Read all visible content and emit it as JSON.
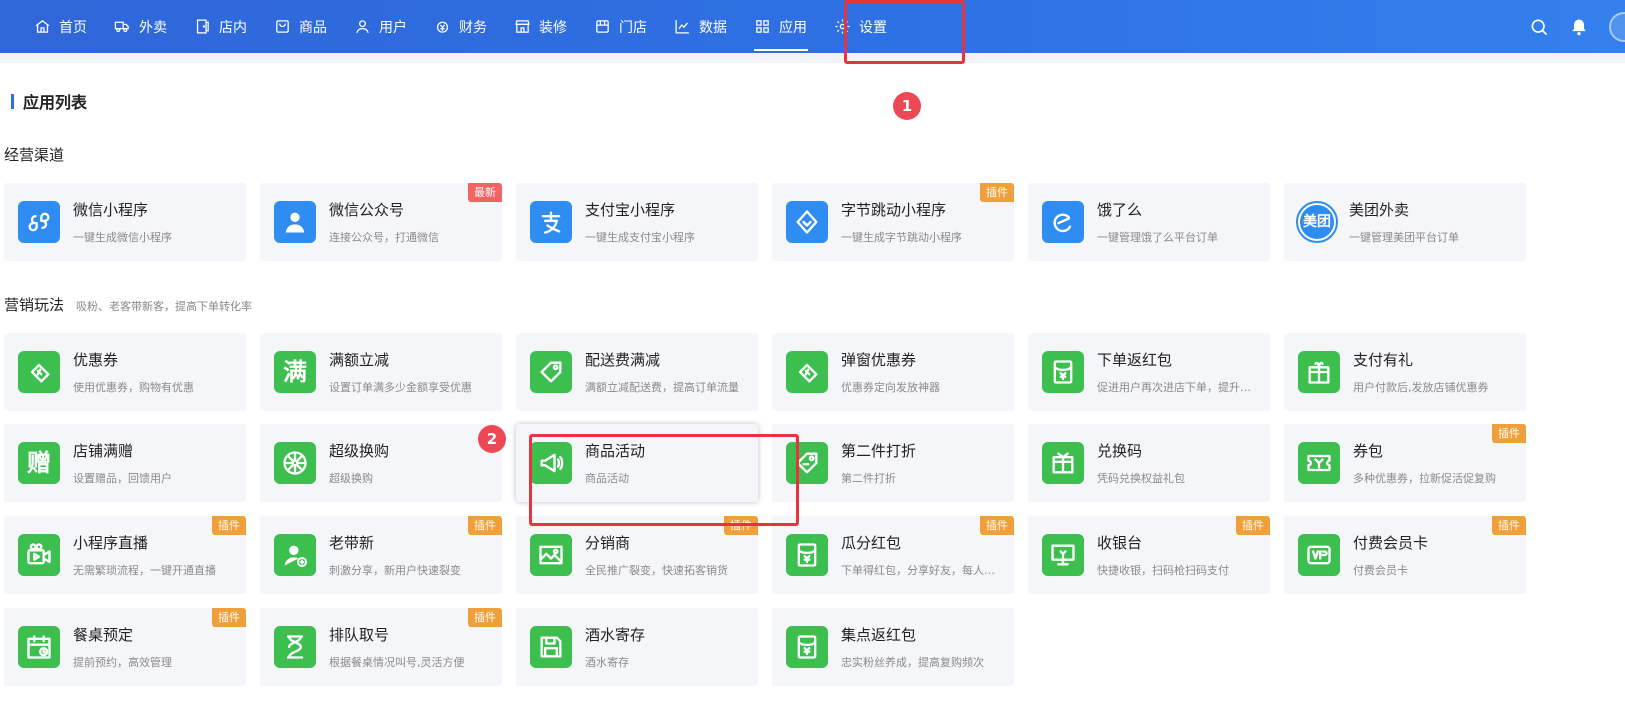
{
  "nav": {
    "items": [
      {
        "label": "首页",
        "icon": "home-icon"
      },
      {
        "label": "外卖",
        "icon": "delivery-icon"
      },
      {
        "label": "店内",
        "icon": "store-door-icon"
      },
      {
        "label": "商品",
        "icon": "product-icon"
      },
      {
        "label": "用户",
        "icon": "user-icon"
      },
      {
        "label": "财务",
        "icon": "finance-icon"
      },
      {
        "label": "装修",
        "icon": "decoration-icon"
      },
      {
        "label": "门店",
        "icon": "shop-icon"
      },
      {
        "label": "数据",
        "icon": "chart-icon"
      },
      {
        "label": "应用",
        "icon": "apps-icon",
        "active": true
      },
      {
        "label": "设置",
        "icon": "gear-icon"
      }
    ]
  },
  "markers": {
    "one": "1",
    "two": "2"
  },
  "page_title": "应用列表",
  "sections": {
    "channels": {
      "title": "经营渠道",
      "subtitle": ""
    },
    "marketing": {
      "title": "营销玩法",
      "subtitle": "吸粉、老客带新客，提高下单转化率"
    }
  },
  "colors": {
    "nav": "#2e6ee6",
    "blue_icon": "#2f8cf0",
    "green_icon": "#3cbf4f",
    "tag_orange": "#f0a03a",
    "tag_red": "#f26363",
    "highlight": "#e8323c"
  },
  "channels": [
    {
      "name": "微信小程序",
      "desc": "一键生成微信小程序",
      "icon": "mini-program-icon",
      "tag": ""
    },
    {
      "name": "微信公众号",
      "desc": "连接公众号，打通微信",
      "icon": "official-account-icon",
      "tag": "最新"
    },
    {
      "name": "支付宝小程序",
      "desc": "一键生成支付宝小程序",
      "icon": "alipay-icon",
      "tag": ""
    },
    {
      "name": "字节跳动小程序",
      "desc": "一键生成字节跳动小程序",
      "icon": "bytedance-icon",
      "tag": "插件"
    },
    {
      "name": "饿了么",
      "desc": "一键管理饿了么平台订单",
      "icon": "eleme-icon",
      "tag": ""
    },
    {
      "name": "美团外卖",
      "desc": "一键管理美团平台订单",
      "icon": "meituan-icon",
      "icon_text": "美团",
      "tag": ""
    }
  ],
  "marketing": [
    {
      "name": "优惠券",
      "desc": "使用优惠券，购物有优惠",
      "icon": "coupon-icon",
      "tag": ""
    },
    {
      "name": "满额立减",
      "desc": "设置订单满多少金额享受优惠",
      "icon": "full-reduction-icon",
      "icon_text": "满",
      "tag": ""
    },
    {
      "name": "配送费满减",
      "desc": "满额立减配送费，提高订单流量",
      "icon": "delivery-fee-tag-icon",
      "tag": ""
    },
    {
      "name": "弹窗优惠券",
      "desc": "优惠券定向发放神器",
      "icon": "popup-coupon-icon",
      "tag": ""
    },
    {
      "name": "下单返红包",
      "desc": "促进用户再次进店下单，提升复购率",
      "icon": "red-packet-icon",
      "tag": ""
    },
    {
      "name": "支付有礼",
      "desc": "用户付款后,发放店铺优惠券",
      "icon": "gift-icon",
      "tag": ""
    },
    {
      "name": "店铺满赠",
      "desc": "设置赠品，回馈用户",
      "icon": "store-gift-icon",
      "icon_text": "赠",
      "tag": ""
    },
    {
      "name": "超级换购",
      "desc": "超级换购",
      "icon": "wheel-icon",
      "tag": ""
    },
    {
      "name": "商品活动",
      "desc": "商品活动",
      "icon": "megaphone-icon",
      "tag": "",
      "selected": true
    },
    {
      "name": "第二件打折",
      "desc": "第二件打折",
      "icon": "discount-tag-icon",
      "tag": ""
    },
    {
      "name": "兑换码",
      "desc": "凭码兑换权益礼包",
      "icon": "redeem-code-icon",
      "tag": ""
    },
    {
      "name": "券包",
      "desc": "多种优惠券，拉新促活促复购",
      "icon": "coupon-pack-icon",
      "tag": "插件"
    },
    {
      "name": "小程序直播",
      "desc": "无需繁琐流程，一键开通直播",
      "icon": "live-video-icon",
      "tag": "插件"
    },
    {
      "name": "老带新",
      "desc": "刺激分享，新用户快速裂变",
      "icon": "invite-user-icon",
      "tag": "插件"
    },
    {
      "name": "分销商",
      "desc": "全民推广裂变，快速拓客销货",
      "icon": "picture-icon",
      "tag": "插件"
    },
    {
      "name": "瓜分红包",
      "desc": "下单得红包，分享好友，每人都可领取",
      "icon": "share-red-packet-icon",
      "tag": "插件"
    },
    {
      "name": "收银台",
      "desc": "快捷收银，扫码枪扫码支付",
      "icon": "cashier-icon",
      "tag": "插件"
    },
    {
      "name": "付费会员卡",
      "desc": "付费会员卡",
      "icon": "vip-card-icon",
      "tag": "插件"
    },
    {
      "name": "餐桌预定",
      "desc": "提前预约，高效管理",
      "icon": "reservation-icon",
      "tag": "插件"
    },
    {
      "name": "排队取号",
      "desc": "根据餐桌情况叫号,灵活方便",
      "icon": "hourglass-icon",
      "tag": "插件"
    },
    {
      "name": "酒水寄存",
      "desc": "酒水寄存",
      "icon": "storage-icon",
      "tag": ""
    },
    {
      "name": "集点返红包",
      "desc": "忠实粉丝养成，提高复购频次",
      "icon": "points-red-packet-icon",
      "tag": ""
    }
  ]
}
